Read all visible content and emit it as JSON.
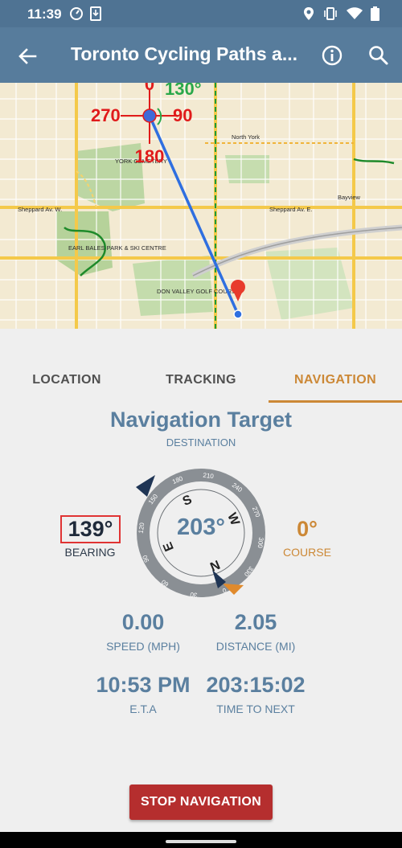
{
  "status_bar": {
    "time": "11:39"
  },
  "app_bar": {
    "title": "Toronto Cycling Paths a..."
  },
  "map": {
    "overlay": {
      "north": "0",
      "east": "90",
      "south": "180",
      "west": "270",
      "heading": "130°"
    },
    "labels": [
      "Sheppard Av. W.",
      "Sheppard Av. E.",
      "DON VALLEY GOLF COURSE",
      "YORK CEMETERY",
      "EARL BALES PARK & SKI CENTRE",
      "Bayview",
      "North York"
    ],
    "colors": {
      "route": "#2f6fe0",
      "overlay": "#e01b1b",
      "heading": "#2aa84a",
      "marker": "#e83b2c"
    }
  },
  "tabs": [
    {
      "label": "LOCATION",
      "active": false
    },
    {
      "label": "TRACKING",
      "active": false
    },
    {
      "label": "NAVIGATION",
      "active": true
    }
  ],
  "navigation": {
    "title": "Navigation Target",
    "subtitle": "DESTINATION",
    "bearing": {
      "value": "139°",
      "label": "BEARING"
    },
    "compass": {
      "value": "203°",
      "letters": [
        "S",
        "W",
        "N",
        "E"
      ],
      "ticks": [
        "180",
        "210",
        "240",
        "270",
        "300",
        "330",
        "0",
        "30",
        "60",
        "90",
        "120",
        "150"
      ]
    },
    "course": {
      "value": "0°",
      "label": "COURSE"
    },
    "speed": {
      "value": "0.00",
      "label": "SPEED (MPH)"
    },
    "distance": {
      "value": "2.05",
      "label": "DISTANCE (MI)"
    },
    "eta": {
      "value": "10:53 PM",
      "label": "E.T.A"
    },
    "time_to_next": {
      "value": "203:15:02",
      "label": "TIME TO NEXT"
    }
  },
  "actions": {
    "stop_label": "STOP NAVIGATION"
  },
  "colors": {
    "accent": "#cc8836",
    "primary": "#577c9c",
    "stop": "#b52e2e",
    "bearing_box": "#e03333"
  }
}
